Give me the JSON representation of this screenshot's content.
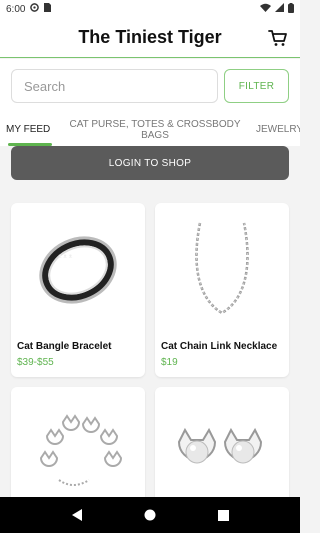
{
  "status_bar": {
    "time": "6:00",
    "icons": [
      "settings-icon",
      "sim-icon",
      "wifi-icon",
      "signal-icon",
      "battery-icon"
    ]
  },
  "header": {
    "title": "The Tiniest Tiger",
    "cart_icon": "cart-icon"
  },
  "search": {
    "placeholder": "Search",
    "filter_label": "FILTER"
  },
  "tabs": [
    {
      "label": "MY FEED",
      "active": true
    },
    {
      "label": "CAT PURSE, TOTES & CROSSBODY BAGS",
      "active": false
    },
    {
      "label": "JEWELRY",
      "active": false
    }
  ],
  "login_button": "LOGIN TO SHOP",
  "products": [
    {
      "name": "Cat  Bangle Bracelet",
      "price": "$39-$55",
      "icon": "bangle-bracelet-image"
    },
    {
      "name": "Cat Chain Link Necklace",
      "price": "$19",
      "icon": "chain-necklace-image"
    },
    {
      "name": "",
      "price": "",
      "icon": "cat-link-bracelet-image"
    },
    {
      "name": "",
      "price": "",
      "icon": "cat-stud-earrings-image"
    }
  ],
  "colors": {
    "accent": "#5fb44f",
    "login_bg": "#5b5b5b",
    "nav_bg": "#000000"
  },
  "nav": [
    "back-icon",
    "home-icon",
    "recents-icon"
  ]
}
